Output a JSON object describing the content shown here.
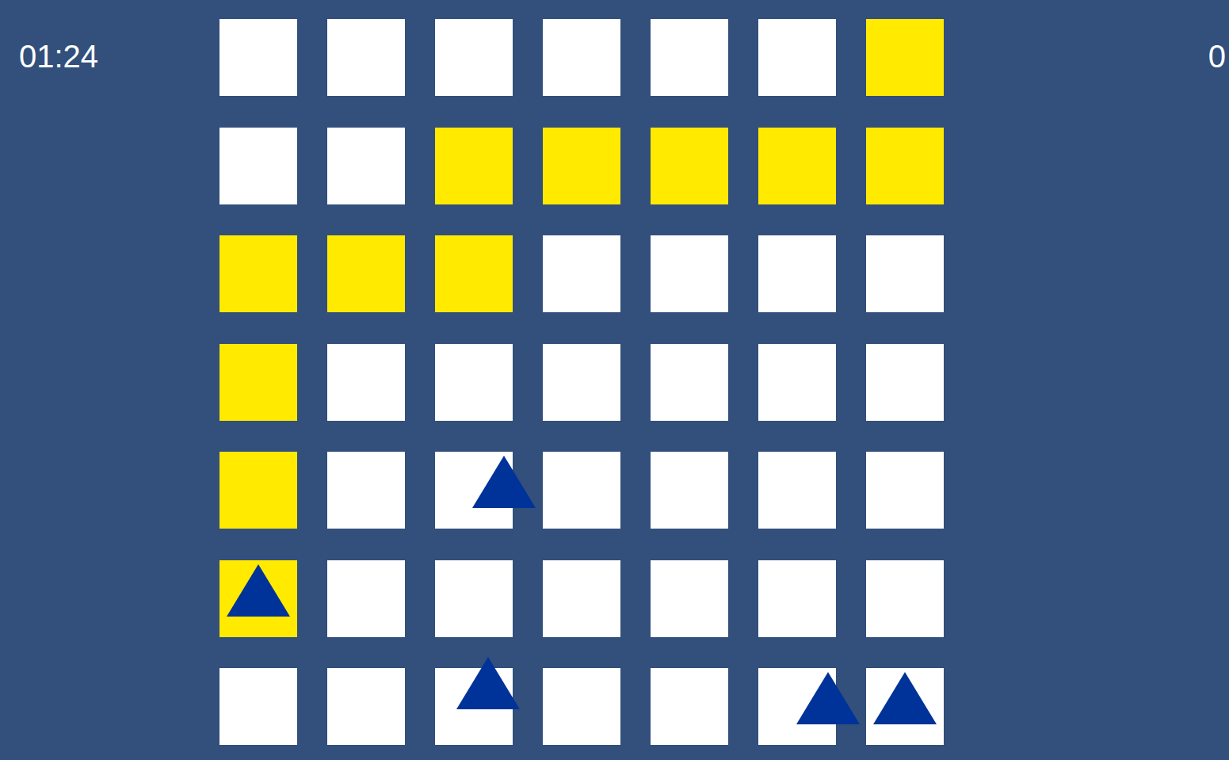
{
  "timer": "01:24",
  "score": "0",
  "board": [
    [
      {
        "lit": false
      },
      {
        "lit": false
      },
      {
        "lit": false
      },
      {
        "lit": false
      },
      {
        "lit": false
      },
      {
        "lit": false
      },
      {
        "lit": true
      }
    ],
    [
      {
        "lit": false
      },
      {
        "lit": false
      },
      {
        "lit": true
      },
      {
        "lit": true
      },
      {
        "lit": true
      },
      {
        "lit": true
      },
      {
        "lit": true
      }
    ],
    [
      {
        "lit": true
      },
      {
        "lit": true
      },
      {
        "lit": true
      },
      {
        "lit": false
      },
      {
        "lit": false
      },
      {
        "lit": false
      },
      {
        "lit": false
      }
    ],
    [
      {
        "lit": true
      },
      {
        "lit": false
      },
      {
        "lit": false
      },
      {
        "lit": false
      },
      {
        "lit": false
      },
      {
        "lit": false
      },
      {
        "lit": false
      }
    ],
    [
      {
        "lit": true
      },
      {
        "lit": false
      },
      {
        "lit": false
      },
      {
        "lit": false
      },
      {
        "lit": false
      },
      {
        "lit": false
      },
      {
        "lit": false
      }
    ],
    [
      {
        "lit": true
      },
      {
        "lit": false
      },
      {
        "lit": false
      },
      {
        "lit": false
      },
      {
        "lit": false
      },
      {
        "lit": false
      },
      {
        "lit": false
      }
    ],
    [
      {
        "lit": false
      },
      {
        "lit": false
      },
      {
        "lit": false
      },
      {
        "lit": false
      },
      {
        "lit": false
      },
      {
        "lit": false
      },
      {
        "lit": false
      }
    ]
  ],
  "pieces": [
    {
      "row": 4,
      "col": 2,
      "fx": 0.89,
      "fy": 0.05
    },
    {
      "row": 5,
      "col": 0,
      "fx": 0.5,
      "fy": 0.06
    },
    {
      "row": 6,
      "col": 2,
      "fx": 0.68,
      "fy": -0.14
    },
    {
      "row": 6,
      "col": 5,
      "fx": 0.9,
      "fy": 0.05
    },
    {
      "row": 6,
      "col": 6,
      "fx": 0.5,
      "fy": 0.05
    }
  ]
}
